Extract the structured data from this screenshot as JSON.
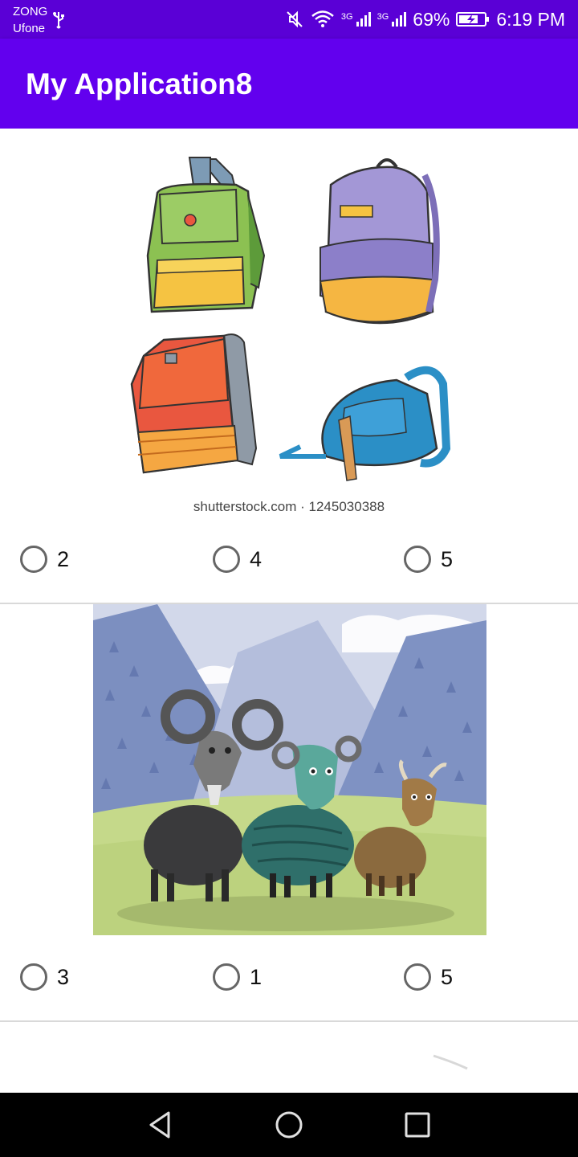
{
  "status": {
    "carrier_top": "ZONG",
    "carrier_bottom": "Ufone",
    "network_label": "3G",
    "battery": "69%",
    "time": "6:19 PM"
  },
  "app_bar": {
    "title": "My Application8"
  },
  "questions": [
    {
      "image": {
        "subject": "four backpacks",
        "watermark": "shutterstock.com · 1245030388"
      },
      "options": [
        "2",
        "4",
        "5"
      ]
    },
    {
      "image": {
        "subject": "three goats in mountains"
      },
      "options": [
        "3",
        "1",
        "5"
      ]
    }
  ],
  "colors": {
    "status_bar": "#5a00d6",
    "app_bar": "#6200ee",
    "nav_bar": "#000000",
    "radio_outline": "#666666"
  },
  "icons": [
    "usb-icon",
    "mute-icon",
    "wifi-icon",
    "signal-icon",
    "battery-icon",
    "back-icon",
    "home-icon",
    "recents-icon"
  ]
}
